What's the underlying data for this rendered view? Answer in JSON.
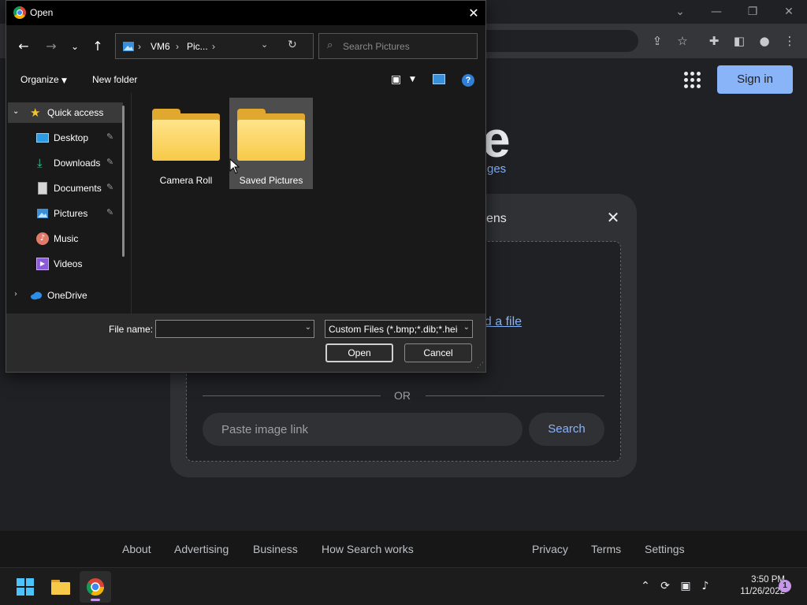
{
  "browser": {
    "signin_label": "Sign in",
    "logo_fragment": "e",
    "images_fragment": "ges",
    "lens_title_fragment": "ens",
    "upload_link_fragment": "ad a file",
    "or_text": "OR",
    "paste_placeholder": "Paste image link",
    "search_label": "Search",
    "footer": {
      "left": [
        "About",
        "Advertising",
        "Business",
        "How Search works"
      ],
      "right": [
        "Privacy",
        "Terms",
        "Settings"
      ]
    }
  },
  "taskbar": {
    "time": "3:50 PM",
    "date": "11/26/2022",
    "notification_count": "1",
    "accent_color": "#c597e8"
  },
  "dialog": {
    "title": "Open",
    "address": {
      "root": "VM6",
      "current": "Pic...",
      "sep": "›"
    },
    "search_placeholder": "Search Pictures",
    "commands": {
      "organize": "Organize",
      "new_folder": "New folder"
    },
    "nav_pane": [
      {
        "label": "Quick access",
        "icon": "star-icon"
      },
      {
        "label": "Desktop",
        "icon": "desktop-icon"
      },
      {
        "label": "Downloads",
        "icon": "download-icon"
      },
      {
        "label": "Documents",
        "icon": "documents-icon"
      },
      {
        "label": "Pictures",
        "icon": "pictures-icon"
      },
      {
        "label": "Music",
        "icon": "music-icon"
      },
      {
        "label": "Videos",
        "icon": "videos-icon"
      },
      {
        "label": "OneDrive",
        "icon": "cloud-icon"
      }
    ],
    "folders": [
      {
        "label": "Camera Roll"
      },
      {
        "label": "Saved Pictures"
      }
    ],
    "file_name_label": "File name:",
    "file_name_value": "",
    "file_type": "Custom Files (*.bmp;*.dib;*.heic;*.jpg)",
    "open_label": "Open",
    "cancel_label": "Cancel",
    "folder_color": "#f7c948"
  }
}
